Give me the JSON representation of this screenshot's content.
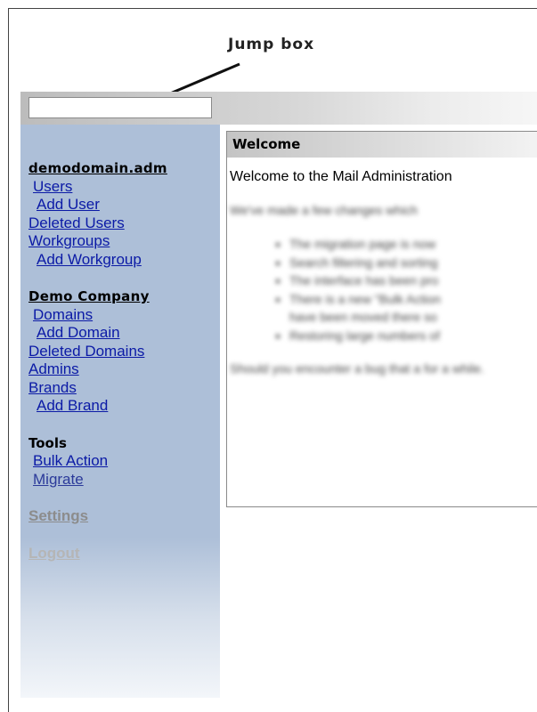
{
  "annotation": {
    "label": "Jump box"
  },
  "jump_box": {
    "value": "",
    "placeholder": ""
  },
  "sidebar": {
    "domain_heading": "demodomain.adm",
    "domain_links": [
      "Users",
      "Add User",
      "Deleted Users",
      "Workgroups",
      "Add Workgroup"
    ],
    "company_heading": "Demo Company",
    "company_links": [
      "Domains",
      "Add Domain",
      "Deleted Domains",
      "Admins",
      "Brands",
      "Add Brand"
    ],
    "tools_heading": "Tools",
    "tools_links": [
      "Bulk Action",
      "Migrate"
    ],
    "settings": "Settings",
    "logout": "Logout"
  },
  "panel": {
    "title": "Welcome",
    "intro": "Welcome to the Mail Administration",
    "blurred_intro": "We've made a few changes which",
    "blurred_items": [
      "The migration page is now",
      "Search filtering and sorting",
      "The interface has been pro",
      "There is a new \"Bulk Action",
      "have been moved there so",
      "Restoring large numbers of"
    ],
    "blurred_footer": "Should you encounter a bug that a for a while."
  }
}
